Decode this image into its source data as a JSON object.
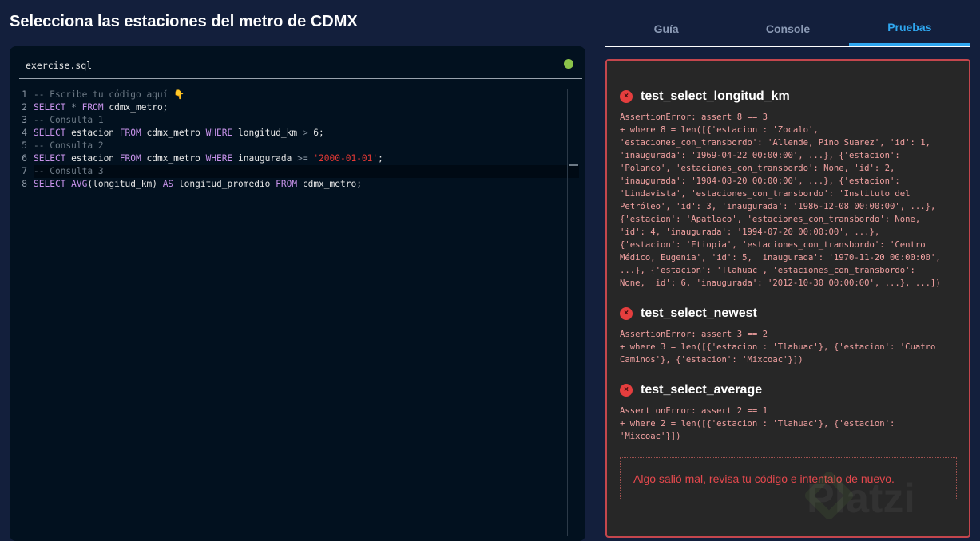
{
  "title": "Selecciona las estaciones del metro de CDMX",
  "editor": {
    "filename": "exercise.sql",
    "status_color": "#8bc34a",
    "lines": [
      [
        {
          "t": "c",
          "v": "-- Escribe tu código aquí 👇"
        }
      ],
      [
        {
          "t": "k",
          "v": "SELECT"
        },
        {
          "t": "o",
          "v": " * "
        },
        {
          "t": "k",
          "v": "FROM"
        },
        {
          "t": "n",
          "v": " cdmx_metro;"
        }
      ],
      [
        {
          "t": "c",
          "v": "-- Consulta 1"
        }
      ],
      [
        {
          "t": "k",
          "v": "SELECT"
        },
        {
          "t": "n",
          "v": " estacion "
        },
        {
          "t": "k",
          "v": "FROM"
        },
        {
          "t": "n",
          "v": " cdmx_metro "
        },
        {
          "t": "k",
          "v": "WHERE"
        },
        {
          "t": "n",
          "v": " longitud_km "
        },
        {
          "t": "o",
          "v": ">"
        },
        {
          "t": "n",
          "v": " 6;"
        }
      ],
      [
        {
          "t": "c",
          "v": "-- Consulta 2"
        }
      ],
      [
        {
          "t": "k",
          "v": "SELECT"
        },
        {
          "t": "n",
          "v": " estacion "
        },
        {
          "t": "k",
          "v": "FROM"
        },
        {
          "t": "n",
          "v": " cdmx_metro "
        },
        {
          "t": "k",
          "v": "WHERE"
        },
        {
          "t": "n",
          "v": " inaugurada "
        },
        {
          "t": "o",
          "v": ">="
        },
        {
          "t": "n",
          "v": " "
        },
        {
          "t": "s",
          "v": "'2000-01-01'"
        },
        {
          "t": "n",
          "v": ";"
        }
      ],
      [
        {
          "t": "c",
          "v": "-- Consulta 3"
        }
      ],
      [
        {
          "t": "k",
          "v": "SELECT"
        },
        {
          "t": "n",
          "v": " "
        },
        {
          "t": "k",
          "v": "AVG"
        },
        {
          "t": "n",
          "v": "(longitud_km) "
        },
        {
          "t": "k",
          "v": "AS"
        },
        {
          "t": "n",
          "v": " longitud_promedio "
        },
        {
          "t": "k",
          "v": "FROM"
        },
        {
          "t": "n",
          "v": " cdmx_metro;"
        }
      ]
    ]
  },
  "tabs": [
    {
      "label": "Guía"
    },
    {
      "label": "Console"
    },
    {
      "label": "Pruebas"
    }
  ],
  "tests": [
    {
      "name": "test_select_longitud_km",
      "error": "AssertionError: assert 8 == 3\n+ where 8 = len([{'estacion': 'Zocalo',\n'estaciones_con_transbordo': 'Allende, Pino Suarez', 'id': 1,\n'inaugurada': '1969-04-22 00:00:00', ...}, {'estacion':\n'Polanco', 'estaciones_con_transbordo': None, 'id': 2,\n'inaugurada': '1984-08-20 00:00:00', ...}, {'estacion':\n'Lindavista', 'estaciones_con_transbordo': 'Instituto del\nPetróleo', 'id': 3, 'inaugurada': '1986-12-08 00:00:00', ...},\n{'estacion': 'Apatlaco', 'estaciones_con_transbordo': None,\n'id': 4, 'inaugurada': '1994-07-20 00:00:00', ...},\n{'estacion': 'Etiopia', 'estaciones_con_transbordo': 'Centro\nMédico, Eugenia', 'id': 5, 'inaugurada': '1970-11-20 00:00:00',\n...}, {'estacion': 'Tlahuac', 'estaciones_con_transbordo':\nNone, 'id': 6, 'inaugurada': '2012-10-30 00:00:00', ...}, ...])"
    },
    {
      "name": "test_select_newest",
      "error": "AssertionError: assert 3 == 2\n+ where 3 = len([{'estacion': 'Tlahuac'}, {'estacion': 'Cuatro\nCaminos'}, {'estacion': 'Mixcoac'}])"
    },
    {
      "name": "test_select_average",
      "error": "AssertionError: assert 2 == 1\n+ where 2 = len([{'estacion': 'Tlahuac'}, {'estacion':\n'Mixcoac'}])"
    }
  ],
  "result_message": "Algo salió mal, revisa tu código e intentalo de nuevo.",
  "watermark": "Platzi"
}
